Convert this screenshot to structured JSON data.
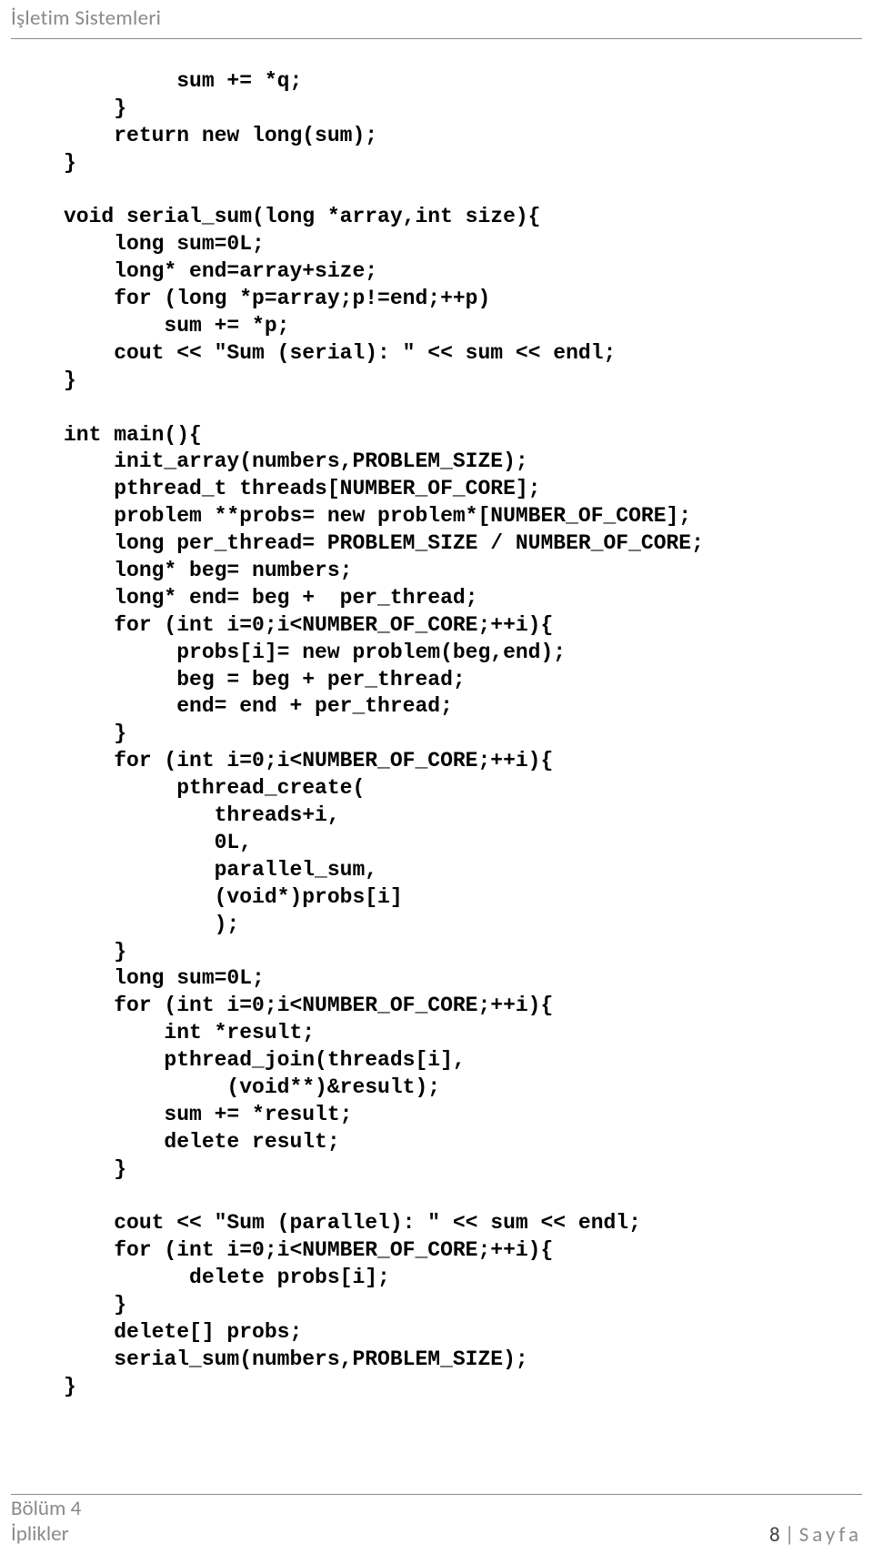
{
  "header": {
    "title": "İşletim Sistemleri"
  },
  "code": {
    "text": "         sum += *q;\n    }\n    return new long(sum);\n}\n\nvoid serial_sum(long *array,int size){\n    long sum=0L;\n    long* end=array+size;\n    for (long *p=array;p!=end;++p)\n        sum += *p;\n    cout << \"Sum (serial): \" << sum << endl;\n}\n\nint main(){\n    init_array(numbers,PROBLEM_SIZE);\n    pthread_t threads[NUMBER_OF_CORE];\n    problem **probs= new problem*[NUMBER_OF_CORE];\n    long per_thread= PROBLEM_SIZE / NUMBER_OF_CORE;\n    long* beg= numbers;\n    long* end= beg +  per_thread;\n    for (int i=0;i<NUMBER_OF_CORE;++i){\n         probs[i]= new problem(beg,end);\n         beg = beg + per_thread;\n         end= end + per_thread;\n    }\n    for (int i=0;i<NUMBER_OF_CORE;++i){\n         pthread_create(\n            threads+i,\n            0L,\n            parallel_sum,\n            (void*)probs[i]\n            );\n    }\n    long sum=0L;\n    for (int i=0;i<NUMBER_OF_CORE;++i){\n        int *result;\n        pthread_join(threads[i],\n             (void**)&result);\n        sum += *result;\n        delete result;\n    }\n\n    cout << \"Sum (parallel): \" << sum << endl;\n    for (int i=0;i<NUMBER_OF_CORE;++i){\n          delete probs[i];\n    }\n    delete[] probs;\n    serial_sum(numbers,PROBLEM_SIZE);\n}"
  },
  "footer": {
    "left_line1": "Bölüm 4",
    "left_line2": "İplikler",
    "page_number": "8",
    "page_sep": " | ",
    "page_word": "Sayfa"
  }
}
